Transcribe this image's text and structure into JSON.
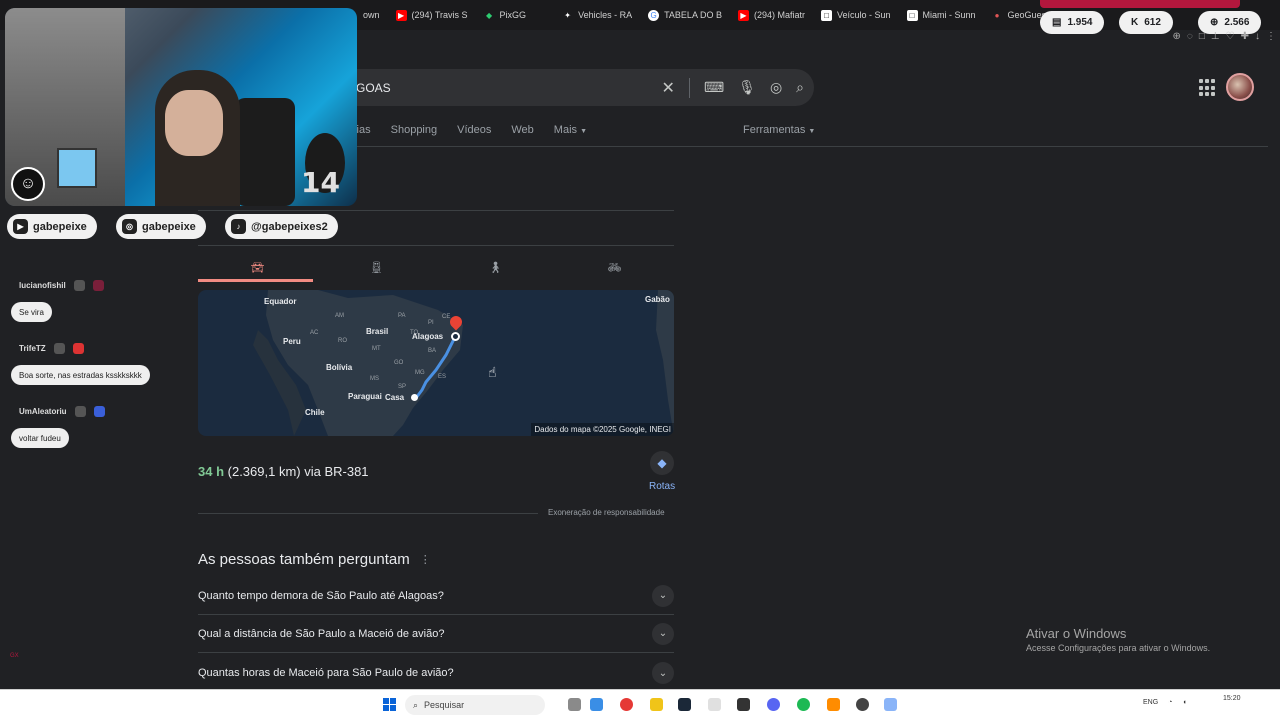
{
  "bookmarks": [
    {
      "label": "own",
      "icon": "bookmark-icon",
      "color": "#555555"
    },
    {
      "label": "(294) Travis S",
      "icon": "youtube-icon",
      "color": "#ff0000"
    },
    {
      "label": "PixGG",
      "icon": "pixgg-icon",
      "color": "#2ecc71"
    },
    {
      "label": "Vehicles - RA",
      "icon": "rage-icon",
      "color": "#ffffff"
    },
    {
      "label": "TABELA DO B",
      "icon": "google-icon",
      "color": "#4285f4"
    },
    {
      "label": "(294) Mafiatr",
      "icon": "youtube-icon",
      "color": "#ff0000"
    },
    {
      "label": "Veículo - Sun",
      "icon": "site-icon",
      "color": "#ffffff"
    },
    {
      "label": "Miami - Sunn",
      "icon": "site-icon",
      "color": "#ffffff"
    },
    {
      "label": "GeoGuessr",
      "icon": "geoguessr-icon",
      "color": "#e05555"
    }
  ],
  "stream_badges": {
    "twitch_viewers": "1.954",
    "kick_viewers": "612",
    "total_viewers": "2.566"
  },
  "search": {
    "query": "GOAS"
  },
  "nav": {
    "tabs": [
      "ícias",
      "Shopping",
      "Vídeos",
      "Web",
      "Mais"
    ],
    "tools": "Ferramentas"
  },
  "directions": {
    "modes": [
      "car-icon",
      "transit-icon",
      "walk-icon",
      "bike-icon"
    ],
    "map_labels": {
      "equador": "Equador",
      "gabao": "Gabão",
      "brasil": "Brasil",
      "peru": "Peru",
      "bolivia": "Bolívia",
      "paraguai": "Paraguai",
      "chile": "Chile",
      "alagoas": "Alagoas",
      "casa": "Casa",
      "am": "AM",
      "pa": "PA",
      "ac": "AC",
      "ro": "RO",
      "mt": "MT",
      "go": "GO",
      "mg": "MG",
      "sp": "SP",
      "ms": "MS",
      "to": "TO",
      "pi": "PI",
      "ba": "BA",
      "ce": "CE",
      "es": "ES"
    },
    "map_credit": "Dados do mapa ©2025 Google, INEGI",
    "duration": "34 h",
    "route_text": "(2.369,1 km) via BR-381",
    "rotas_label": "Rotas",
    "disclaimer": "Exoneração de responsabilidade"
  },
  "paa": {
    "title": "As pessoas também perguntam",
    "questions": [
      "Quanto tempo demora de São Paulo até Alagoas?",
      "Qual a distância de São Paulo a Maceió de avião?",
      "Quantas horas de Maceió para São Paulo de avião?"
    ]
  },
  "windows_activation": {
    "title": "Ativar o Windows",
    "subtitle": "Acesse Configurações para ativar o Windows."
  },
  "taskbar": {
    "search_placeholder": "Pesquisar",
    "lang": "ENG",
    "time": "15:20"
  },
  "stream": {
    "cam_number": "14",
    "socials": [
      {
        "icon": "youtube-icon",
        "handle": "gabepeixe"
      },
      {
        "icon": "instagram-icon",
        "handle": "gabepeixe"
      },
      {
        "icon": "tiktok-icon",
        "handle": "@gabepeixes2"
      }
    ],
    "chat": [
      {
        "user": "lucianofishil",
        "message": "Se vira"
      },
      {
        "user": "TrifeTZ",
        "message": "Boa sorte, nas estradas ksskkskkk"
      },
      {
        "user": "UmAleatoriu",
        "message": "voltar fudeu"
      }
    ],
    "chat_side_label": "GX"
  }
}
